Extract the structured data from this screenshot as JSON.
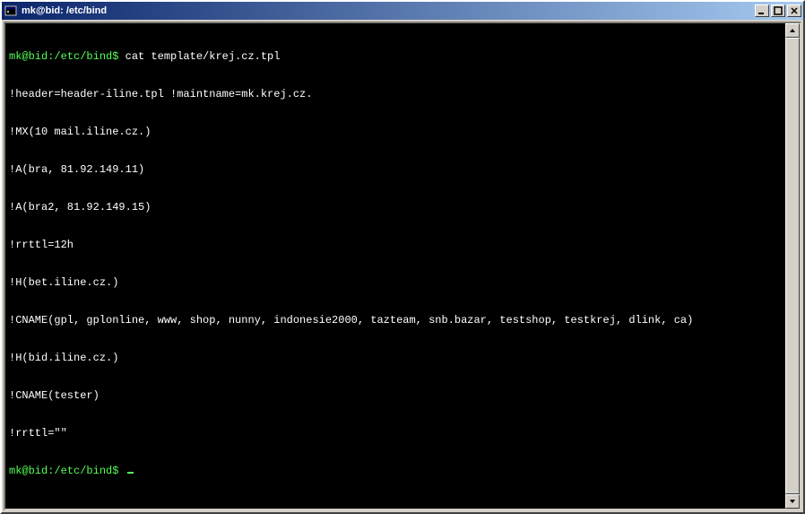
{
  "window": {
    "title": "mk@bid: /etc/bind"
  },
  "terminal": {
    "prompt1": "mk@bid:/etc/bind$",
    "command": " cat template/krej.cz.tpl",
    "lines": [
      "!header=header-iline.tpl !maintname=mk.krej.cz.",
      "!MX(10 mail.iline.cz.)",
      "!A(bra, 81.92.149.11)",
      "!A(bra2, 81.92.149.15)",
      "!rrttl=12h",
      "!H(bet.iline.cz.)",
      "!CNAME(gpl, gplonline, www, shop, nunny, indonesie2000, tazteam, snb.bazar, testshop, testkrej, dlink, ca)",
      "!H(bid.iline.cz.)",
      "!CNAME(tester)",
      "!rrttl=\"\""
    ],
    "prompt2": "mk@bid:/etc/bind$"
  }
}
